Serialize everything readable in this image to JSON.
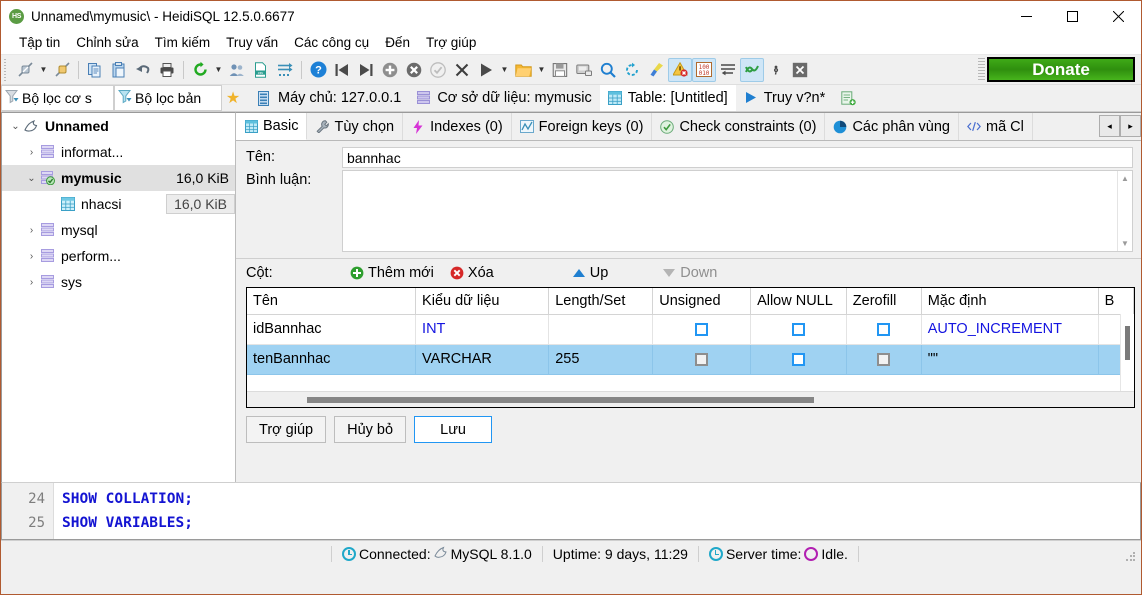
{
  "window": {
    "title": "Unnamed\\mymusic\\ - HeidiSQL 12.5.0.6677",
    "logo_text": "HS",
    "minimize": "–",
    "maximize": "☐",
    "close": "✕"
  },
  "menu": {
    "items": [
      {
        "label": "Tập tin"
      },
      {
        "label": "Chỉnh sửa"
      },
      {
        "label": "Tìm kiếm"
      },
      {
        "label": "Truy vấn"
      },
      {
        "label": "Các công cụ"
      },
      {
        "label": "Đến"
      },
      {
        "label": "Trợ giúp"
      }
    ]
  },
  "toolbar": {
    "donate_label": "Donate",
    "buttons": [
      {
        "name": "connect-icon",
        "kind": "plug"
      },
      {
        "name": "connect-dropdown-icon",
        "kind": "caret"
      },
      {
        "name": "disconnect-icon",
        "kind": "plug2"
      },
      {
        "name": "sep",
        "kind": "sep"
      },
      {
        "name": "copy-icon",
        "kind": "copy"
      },
      {
        "name": "paste-icon",
        "kind": "paste"
      },
      {
        "name": "undo-icon",
        "kind": "undo"
      },
      {
        "name": "print-icon",
        "kind": "print"
      },
      {
        "name": "sep",
        "kind": "sep"
      },
      {
        "name": "refresh-icon",
        "kind": "refresh"
      },
      {
        "name": "refresh-dropdown-icon",
        "kind": "caret"
      },
      {
        "name": "users-icon",
        "kind": "users"
      },
      {
        "name": "import-csv-icon",
        "kind": "csv"
      },
      {
        "name": "export-grid-icon",
        "kind": "export"
      },
      {
        "name": "sep",
        "kind": "sep"
      },
      {
        "name": "help-icon",
        "kind": "help"
      },
      {
        "name": "previous-tab-icon",
        "kind": "prev"
      },
      {
        "name": "next-tab-icon",
        "kind": "next"
      },
      {
        "name": "insert-row-icon",
        "kind": "plus"
      },
      {
        "name": "delete-row-icon",
        "kind": "minus"
      },
      {
        "name": "apply-changes-icon",
        "kind": "check"
      },
      {
        "name": "cancel-changes-icon",
        "kind": "xmark"
      },
      {
        "name": "execute-query-icon",
        "kind": "play"
      },
      {
        "name": "execute-dropdown-icon",
        "kind": "caret"
      },
      {
        "name": "open-file-icon",
        "kind": "folder"
      },
      {
        "name": "open-dropdown-icon",
        "kind": "caret"
      },
      {
        "name": "save-file-icon",
        "kind": "save"
      },
      {
        "name": "save-as-icon",
        "kind": "saveas"
      },
      {
        "name": "find-icon",
        "kind": "find"
      },
      {
        "name": "replace-icon",
        "kind": "replace"
      },
      {
        "name": "format-sql-icon",
        "kind": "brush"
      },
      {
        "name": "stop-on-errors-icon",
        "kind": "warn",
        "highlighted": true
      },
      {
        "name": "binary-view-icon",
        "kind": "binary",
        "highlighted": true
      },
      {
        "name": "word-wrap-icon",
        "kind": "wrap"
      },
      {
        "name": "sql-help-icon",
        "kind": "link",
        "highlighted": true
      },
      {
        "name": "delimiter-icon",
        "kind": "semicolon"
      },
      {
        "name": "close-tab-icon",
        "kind": "closebox"
      }
    ]
  },
  "filterbar": {
    "database_filter": "Bộ lọc cơ s",
    "table_filter": "Bộ lọc bản",
    "favorites_icon": "star-icon"
  },
  "session_tabs": [
    {
      "label": "Máy chủ: 127.0.0.1",
      "icon": "server-icon",
      "active": false
    },
    {
      "label": "Cơ sở dữ liệu: mymusic",
      "icon": "database-icon",
      "active": false
    },
    {
      "label": "Table: [Untitled]",
      "icon": "table-icon",
      "active": true
    },
    {
      "label": "Truy v?n*",
      "icon": "play-icon",
      "active": false
    },
    {
      "label": "",
      "icon": "new-query-tab-icon",
      "active": false
    }
  ],
  "sidebar": {
    "nodes": [
      {
        "label": "Unnamed",
        "size": "",
        "indent": 0,
        "expander": "v",
        "icon": "dolphin-icon",
        "bold": true,
        "selected": false
      },
      {
        "label": "informat...",
        "size": "",
        "indent": 1,
        "expander": ">",
        "icon": "db-icon",
        "bold": false,
        "selected": false
      },
      {
        "label": "mymusic",
        "size": "16,0 KiB",
        "indent": 1,
        "expander": "v",
        "icon": "db-active-icon",
        "bold": true,
        "selected": true
      },
      {
        "label": "nhacsi",
        "size": "16,0 KiB",
        "indent": 2,
        "expander": "",
        "icon": "table-icon",
        "bold": false,
        "selected": false,
        "size_boxed": true
      },
      {
        "label": "mysql",
        "size": "",
        "indent": 1,
        "expander": ">",
        "icon": "db-icon",
        "bold": false,
        "selected": false
      },
      {
        "label": "perform...",
        "size": "",
        "indent": 1,
        "expander": ">",
        "icon": "db-icon",
        "bold": false,
        "selected": false
      },
      {
        "label": "sys",
        "size": "",
        "indent": 1,
        "expander": ">",
        "icon": "db-icon",
        "bold": false,
        "selected": false
      }
    ]
  },
  "editor_tabs": [
    {
      "label": "Basic",
      "icon": "table-icon",
      "active": true
    },
    {
      "label": "Tùy chọn",
      "icon": "wrench-icon",
      "active": false
    },
    {
      "label": "Indexes (0)",
      "icon": "lightning-icon",
      "active": false
    },
    {
      "label": "Foreign keys (0)",
      "icon": "fk-icon",
      "active": false
    },
    {
      "label": "Check constraints (0)",
      "icon": "check-icon",
      "active": false
    },
    {
      "label": "Các phân vùng",
      "icon": "pie-icon",
      "active": false
    },
    {
      "label": "mã Cl",
      "icon": "code-icon",
      "active": false
    }
  ],
  "tab_scroll": {
    "left": "◂",
    "right": "▸"
  },
  "form": {
    "name_label": "Tên:",
    "name_value": "bannhac",
    "comment_label": "Bình luận:",
    "comment_value": ""
  },
  "columns_toolbar": {
    "label": "Cột:",
    "add_label": "Thêm mới",
    "remove_label": "Xóa",
    "up_label": "Up",
    "down_label": "Down"
  },
  "grid": {
    "headers": [
      "Tên",
      "Kiểu dữ liệu",
      "Length/Set",
      "Unsigned",
      "Allow NULL",
      "Zerofill",
      "Mặc định",
      "B"
    ],
    "rows": [
      {
        "selected": false,
        "name": "idBannhac",
        "datatype": "INT",
        "length": "",
        "unsigned": {
          "checked": false,
          "style": "blue"
        },
        "allow_null": {
          "checked": false,
          "style": "blue"
        },
        "zerofill": {
          "checked": false,
          "style": "blue"
        },
        "default": "AUTO_INCREMENT",
        "default_style": "blue",
        "extra": ""
      },
      {
        "selected": true,
        "name": "tenBannhac",
        "datatype": "VARCHAR",
        "length": "255",
        "unsigned": {
          "checked": false,
          "style": "gray"
        },
        "allow_null": {
          "checked": false,
          "style": "blue"
        },
        "zerofill": {
          "checked": false,
          "style": "gray"
        },
        "default": "\"\"",
        "default_style": "plain",
        "extra": ""
      }
    ]
  },
  "dialog_buttons": [
    {
      "label": "Trợ giúp",
      "focused": false
    },
    {
      "label": "Hủy bỏ",
      "focused": false
    },
    {
      "label": "Lưu",
      "focused": true
    }
  ],
  "sql_log": {
    "lines": [
      {
        "number": "24",
        "text": "SHOW COLLATION;"
      },
      {
        "number": "25",
        "text": "SHOW VARIABLES;"
      }
    ]
  },
  "status_bar": {
    "connected_label": "Connected:",
    "connected_value": "MySQL 8.1.0",
    "uptime": "Uptime: 9 days, 11:29",
    "server_time_label": "Server time:",
    "server_time_value": "Idle."
  },
  "colors": {
    "accent_blue": "#1414e0",
    "selection": "#9fd2f2",
    "donate_green": "#2f8f0e",
    "window_border": "#b05a30"
  }
}
